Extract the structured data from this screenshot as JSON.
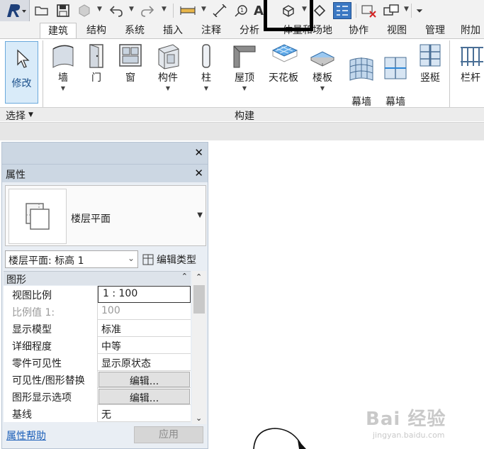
{
  "quick_access": {
    "app_menu_icon": "revit-r-logo",
    "tools": [
      "open-icon",
      "save-icon",
      "sync-icon",
      "undo-icon",
      "redo-icon",
      "measure-icon",
      "dimension-icon",
      "tag-icon",
      "text-icon",
      "3d-view-icon",
      "section-icon",
      "thin-lines-icon",
      "close-hidden-icon",
      "switch-windows-icon",
      "customize-icon"
    ],
    "text_glyph": "A"
  },
  "tabs": [
    "建筑",
    "结构",
    "系统",
    "插入",
    "注释",
    "分析",
    "体量和场地",
    "协作",
    "视图",
    "管理",
    "附加"
  ],
  "active_tab": "建筑",
  "ribbon": {
    "modify_label": "修改",
    "buttons": [
      {
        "label": "墙",
        "icon": "wall-icon",
        "dropdown": true
      },
      {
        "label": "门",
        "icon": "door-icon",
        "dropdown": false
      },
      {
        "label": "窗",
        "icon": "window-icon",
        "dropdown": false
      },
      {
        "label": "构件",
        "icon": "component-icon",
        "dropdown": true
      },
      {
        "label": "柱",
        "icon": "column-icon",
        "dropdown": true
      },
      {
        "label": "屋顶",
        "icon": "roof-icon",
        "dropdown": true
      },
      {
        "label": "天花板",
        "icon": "ceiling-icon",
        "dropdown": false
      },
      {
        "label": "楼板",
        "icon": "floor-icon",
        "dropdown": true
      },
      {
        "label": "幕墙\n系统",
        "icon": "curtain-system-icon",
        "dropdown": false
      },
      {
        "label": "幕墙\n网格",
        "icon": "curtain-grid-icon",
        "dropdown": false
      },
      {
        "label": "竖梃",
        "icon": "mullion-icon",
        "dropdown": false
      },
      {
        "label": "栏杆",
        "icon": "railing-icon",
        "dropdown": false
      }
    ],
    "panel_select_label": "选择",
    "panel_build_label": "构建"
  },
  "properties": {
    "title": "属性",
    "type_name": "楼层平面",
    "instance_selector": "楼层平面: 标高 1",
    "edit_type_label": "编辑类型",
    "group_header": "图形",
    "rows": [
      {
        "name": "视图比例",
        "value": "1 : 100",
        "kind": "input"
      },
      {
        "name": "比例值 1:",
        "value": "100",
        "kind": "disabled"
      },
      {
        "name": "显示模型",
        "value": "标准",
        "kind": "text"
      },
      {
        "name": "详细程度",
        "value": "中等",
        "kind": "text"
      },
      {
        "name": "零件可见性",
        "value": "显示原状态",
        "kind": "text"
      },
      {
        "name": "可见性/图形替换",
        "value": "编辑...",
        "kind": "button"
      },
      {
        "name": "图形显示选项",
        "value": "编辑...",
        "kind": "button"
      },
      {
        "name": "基线",
        "value": "无",
        "kind": "text"
      }
    ],
    "help_link": "属性帮助",
    "apply_label": "应用"
  },
  "watermark": {
    "line1": "Bai 经验",
    "line2": "jingyan.baidu.com"
  }
}
